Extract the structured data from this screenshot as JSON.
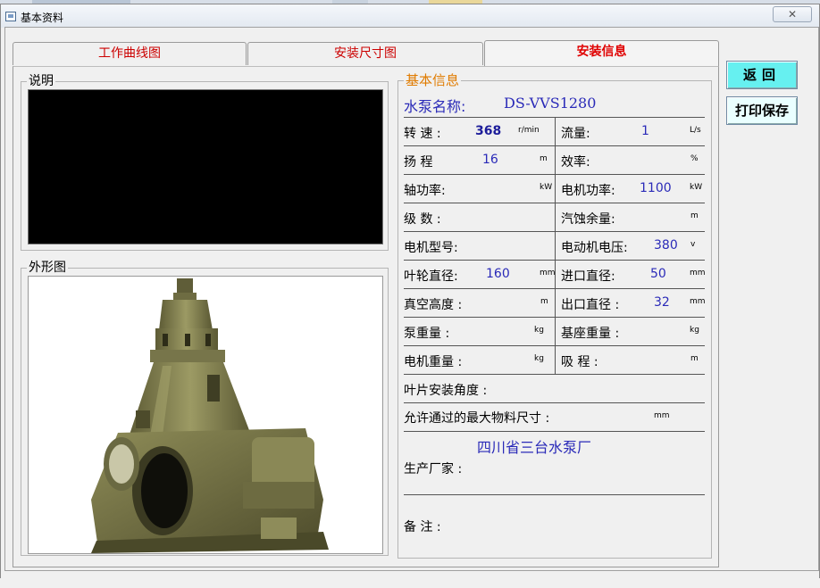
{
  "window": {
    "title": "基本资料",
    "close_label": "✕"
  },
  "tabs": [
    {
      "label": "工作曲线图",
      "active": false
    },
    {
      "label": "安装尺寸图",
      "active": false
    },
    {
      "label": "安装信息",
      "active": true
    }
  ],
  "description": {
    "label": "说明"
  },
  "outline": {
    "label": "外形图"
  },
  "info": {
    "label": "基本信息",
    "pump_name_label": "水泵名称:",
    "pump_name_value": "DS-VVS1280",
    "rows": [
      {
        "left": {
          "label": "转 速 :",
          "value": "368",
          "unit": "r/min"
        },
        "right": {
          "label": "流量:",
          "value": "1",
          "unit": "L/s"
        }
      },
      {
        "left": {
          "label": "扬 程",
          "value": "16",
          "unit": "m"
        },
        "right": {
          "label": "效率:",
          "value": "",
          "unit": "%"
        }
      },
      {
        "left": {
          "label": "轴功率:",
          "value": "",
          "unit": "kW"
        },
        "right": {
          "label": "电机功率:",
          "value": "1100",
          "unit": "kW"
        }
      },
      {
        "left": {
          "label": "级 数 :",
          "value": "",
          "unit": ""
        },
        "right": {
          "label": "汽蚀余量:",
          "value": "",
          "unit": "m"
        }
      },
      {
        "left": {
          "label": "电机型号:",
          "value": "",
          "unit": ""
        },
        "right": {
          "label": "电动机电压:",
          "value": "380",
          "unit": "v"
        }
      },
      {
        "left": {
          "label": "叶轮直径:",
          "value": "160",
          "unit": "mm"
        },
        "right": {
          "label": "进口直径:",
          "value": "50",
          "unit": "mm"
        }
      },
      {
        "left": {
          "label": "真空高度 :",
          "value": "",
          "unit": "m"
        },
        "right": {
          "label": "出口直径 :",
          "value": "32",
          "unit": "mm"
        }
      },
      {
        "left": {
          "label": "泵重量 :",
          "value": "",
          "unit": "kg"
        },
        "right": {
          "label": "基座重量 :",
          "value": "",
          "unit": "kg"
        }
      },
      {
        "left": {
          "label": "电机重量 :",
          "value": "",
          "unit": "kg"
        },
        "right": {
          "label": "吸 程 :",
          "value": "",
          "unit": "m"
        }
      }
    ],
    "blade_angle_label": "叶片安装角度 :",
    "max_material_label": "允许通过的最大物料尺寸 :",
    "max_material_unit": "mm",
    "manufacturer_value": "四川省三台水泵厂",
    "manufacturer_label": "生产厂家 :",
    "remarks_label": "备 注 :"
  },
  "buttons": {
    "back_label": "返回",
    "print_label": "打印保存"
  },
  "colors": {
    "tab_text": "#cc0000",
    "value_text": "#2a2ab8",
    "info_label": "#e07b00",
    "back_button": "#66f0f0",
    "print_button": "#eaffff"
  }
}
